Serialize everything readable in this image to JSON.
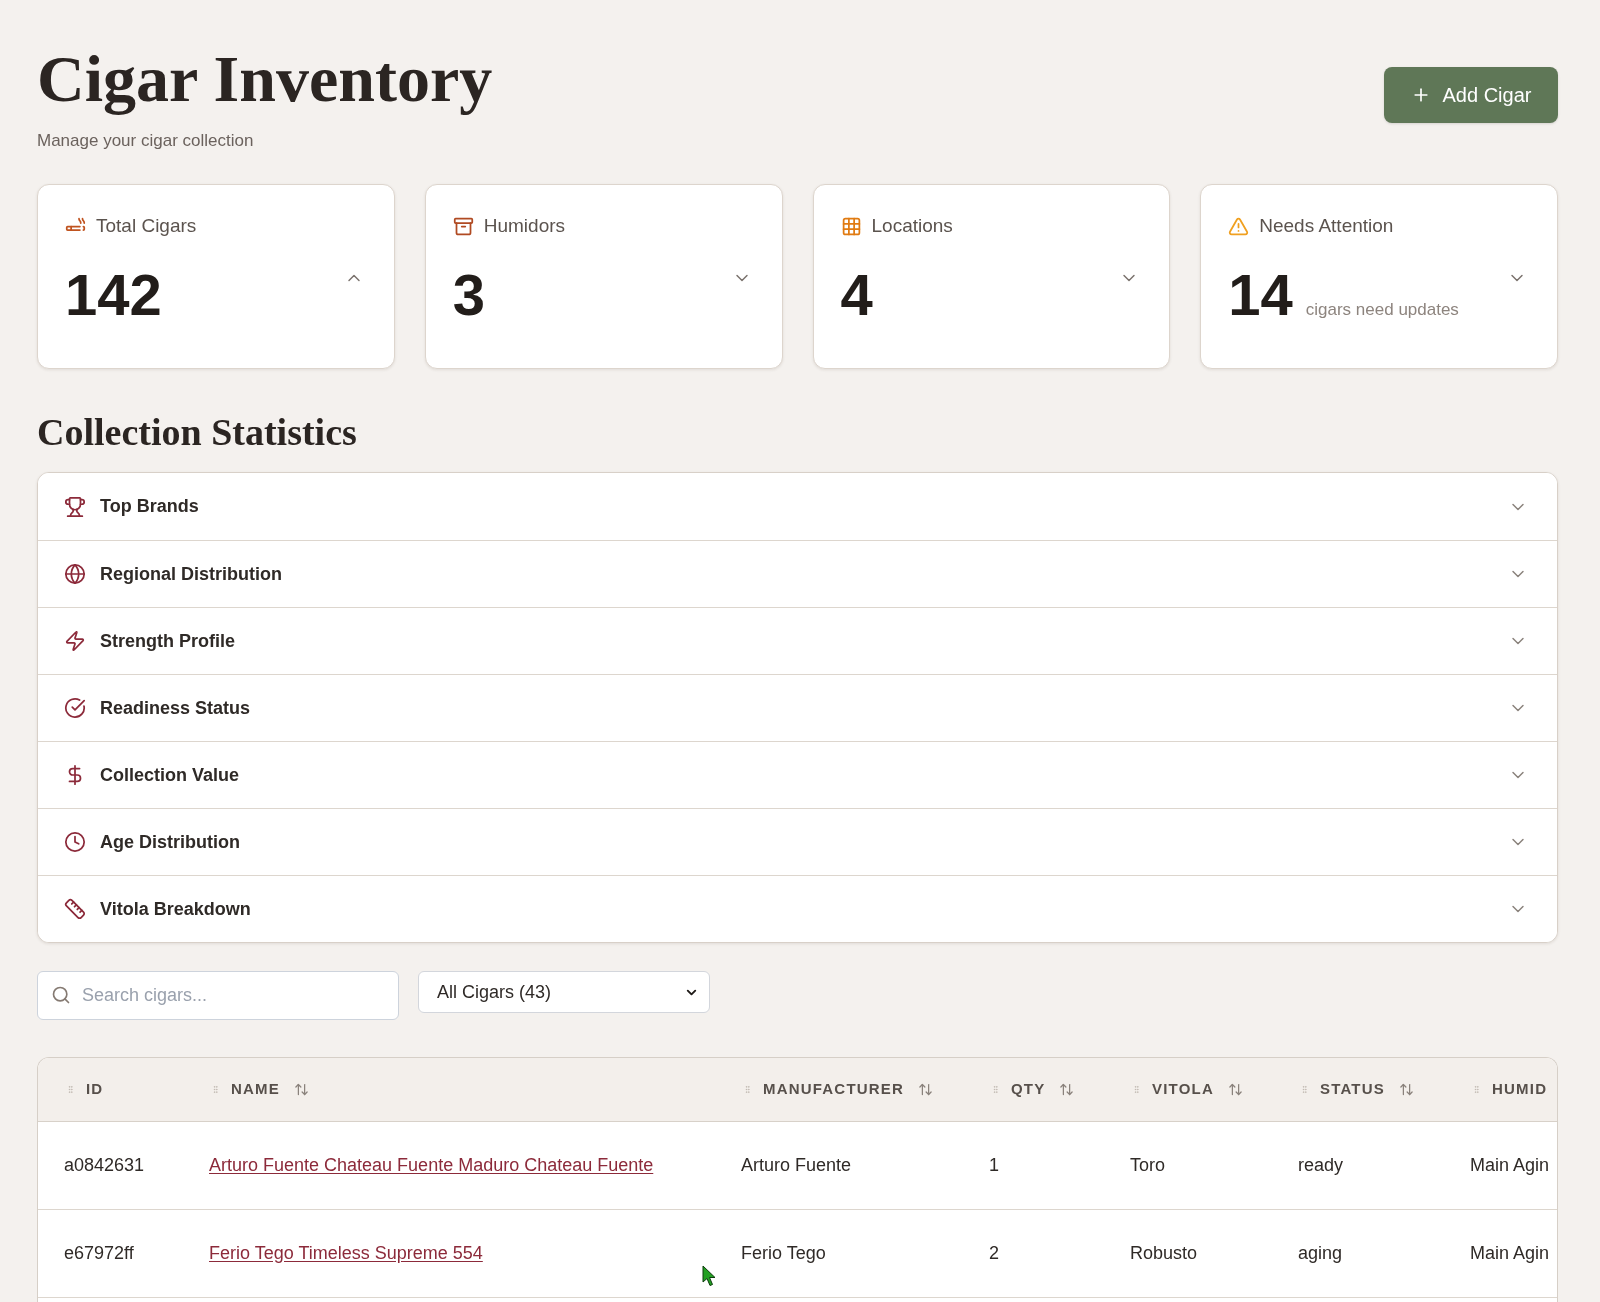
{
  "header": {
    "title": "Cigar Inventory",
    "subtitle": "Manage your cigar collection",
    "add_button": {
      "label": "Add Cigar"
    }
  },
  "stat_cards": [
    {
      "label": "Total Cigars",
      "value": "142",
      "expanded": true
    },
    {
      "label": "Humidors",
      "value": "3",
      "expanded": false
    },
    {
      "label": "Locations",
      "value": "4",
      "expanded": false
    },
    {
      "label": "Needs Attention",
      "value": "14",
      "note": "cigars need updates",
      "expanded": false
    }
  ],
  "statistics": {
    "title": "Collection Statistics",
    "sections": [
      {
        "label": "Top Brands",
        "expanded": false
      },
      {
        "label": "Regional Distribution",
        "expanded": false
      },
      {
        "label": "Strength Profile",
        "expanded": false
      },
      {
        "label": "Readiness Status",
        "expanded": false
      },
      {
        "label": "Collection Value",
        "expanded": false
      },
      {
        "label": "Age Distribution",
        "expanded": false
      },
      {
        "label": "Vitola Breakdown",
        "expanded": false
      }
    ]
  },
  "filters": {
    "search": {
      "placeholder": "Search cigars..."
    },
    "select": {
      "value": "All Cigars (43)"
    }
  },
  "table": {
    "columns": [
      {
        "label": "ID",
        "kind": "text",
        "sortable": false
      },
      {
        "label": "NAME",
        "kind": "link",
        "sortable": true
      },
      {
        "label": "MANUFACTURER",
        "kind": "text",
        "sortable": true
      },
      {
        "label": "QTY",
        "kind": "text",
        "sortable": true
      },
      {
        "label": "VITOLA",
        "kind": "text",
        "sortable": true
      },
      {
        "label": "STATUS",
        "kind": "text",
        "sortable": true
      },
      {
        "label": "HUMID",
        "kind": "text",
        "sortable": false
      }
    ],
    "rows": [
      {
        "cells": [
          "a0842631",
          "Arturo Fuente Chateau Fuente Maduro Chateau Fuente",
          "Arturo Fuente",
          "1",
          "Toro",
          "ready",
          "Main Agin"
        ]
      },
      {
        "cells": [
          "e67972ff",
          "Ferio Tego Timeless Supreme 554",
          "Ferio Tego",
          "2",
          "Robusto",
          "aging",
          "Main Agin"
        ]
      }
    ]
  }
}
